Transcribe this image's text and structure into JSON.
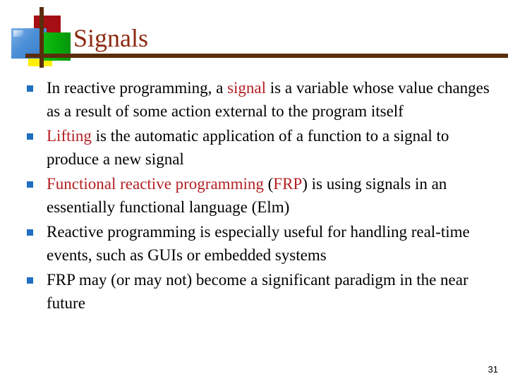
{
  "slide": {
    "title": "Signals",
    "page_number": "31",
    "colors": {
      "title": "#8c2a0e",
      "rule": "#5a2d0c",
      "bullet_marker": "#1f6fc0",
      "highlight": "#b41f23",
      "body_text": "#000000",
      "logo_red": "#a50f13",
      "logo_blue": "#4a8ed6",
      "logo_green": "#06a80a",
      "logo_yellow": "#ffee00"
    },
    "logo": {
      "red_square": "red-square",
      "blue_square": "blue-square",
      "green_square": "green-square",
      "yellow_square": "yellow-square",
      "vertical_bar": "vertical-bar",
      "horizontal_rule": "horizontal-rule"
    },
    "bullets": [
      {
        "marker": "square-bullet",
        "segments": [
          {
            "text": "In reactive programming, a ",
            "style": "normal"
          },
          {
            "text": "signal",
            "style": "highlight"
          },
          {
            "text": " is a variable whose value changes as a result of some action external to the program itself",
            "style": "normal"
          }
        ],
        "plain": "In reactive programming, a signal is a variable whose value changes as a result of some action external to the program itself"
      },
      {
        "marker": "square-bullet",
        "segments": [
          {
            "text": "Lifting",
            "style": "highlight"
          },
          {
            "text": " is the automatic application of a function to a signal to produce a new signal",
            "style": "normal"
          }
        ],
        "plain": "Lifting is the automatic application of a function to a signal to produce a new signal"
      },
      {
        "marker": "square-bullet",
        "segments": [
          {
            "text": "Functional reactive programming",
            "style": "highlight"
          },
          {
            "text": " (",
            "style": "normal"
          },
          {
            "text": "FRP",
            "style": "highlight"
          },
          {
            "text": ") is using signals in an essentially functional language (Elm)",
            "style": "normal"
          }
        ],
        "plain": "Functional reactive programming (FRP) is using signals in an essentially functional language (Elm)"
      },
      {
        "marker": "square-bullet",
        "segments": [
          {
            "text": "Reactive programming is especially useful for handling real-time events, such as GUIs or embedded systems",
            "style": "normal"
          }
        ],
        "plain": "Reactive programming is especially useful for handling real-time events, such as GUIs or embedded systems"
      },
      {
        "marker": "square-bullet",
        "segments": [
          {
            "text": "FRP may (or may not) become a significant paradigm in the near future",
            "style": "normal"
          }
        ],
        "plain": "FRP may (or may not) become a significant paradigm in the near future"
      }
    ]
  }
}
